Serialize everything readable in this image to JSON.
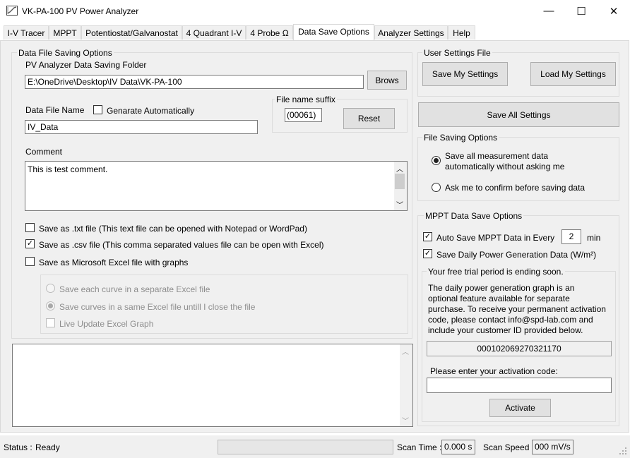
{
  "window": {
    "title": "VK-PA-100 PV Power Analyzer",
    "minimize_glyph": "—",
    "maximize_glyph": "☐",
    "close_glyph": "✕"
  },
  "tabs": [
    {
      "label": "I-V Tracer"
    },
    {
      "label": "MPPT"
    },
    {
      "label": "Potentiostat/Galvanostat"
    },
    {
      "label": "4 Quadrant I-V"
    },
    {
      "label": "4 Probe Ω"
    },
    {
      "label": "Data Save Options"
    },
    {
      "label": "Analyzer Settings"
    },
    {
      "label": "Help"
    }
  ],
  "data_file_saving": {
    "group_label": "Data File Saving Options",
    "folder_label": "PV Analyzer Data Saving Folder",
    "folder_value": "E:\\OneDrive\\Desktop\\IV Data\\VK-PA-100",
    "browse_label": "Brows",
    "file_name_label": "Data File Name",
    "generate_auto_label": "Genarate Automatically",
    "file_name_value": "IV_Data",
    "suffix_group_label": "File name suffix",
    "suffix_value": "(00061)",
    "reset_label": "Reset",
    "comment_label": "Comment",
    "comment_value": "This is test comment.",
    "save_txt_label": "Save as .txt file (This text file can be opened with Notepad or WordPad)",
    "save_csv_label": "Save as .csv file (This comma separated values file can be open with Excel)",
    "save_excel_label": "Save as Microsoft Excel file with graphs",
    "check_glyph": "✓",
    "excel_each_label": "Save each curve in a separate Excel file",
    "excel_same_label": "Save curves in a same Excel file untill I close the file",
    "excel_live_label": "Live Update Excel Graph"
  },
  "user_settings": {
    "group_label": "User Settings File",
    "save_my_label": "Save My Settings",
    "load_my_label": "Load My Settings",
    "save_all_label": "Save All Settings"
  },
  "file_saving_options": {
    "group_label": "File Saving Options",
    "auto_line1": "Save all measurement data",
    "auto_line2": "automatically without asking me",
    "ask_label": "Ask me to confirm before saving data"
  },
  "mppt_options": {
    "group_label": "MPPT Data Save Options",
    "auto_save_label": "Auto Save MPPT Data in Every",
    "interval_value": "2",
    "interval_unit": "min",
    "daily_label": "Save Daily Power Generation Data (W/m²)",
    "trial_group_label": "Your free trial period is ending soon.",
    "trial_lines": [
      "The daily power generation graph is an",
      "optional feature available for separate",
      "purchase. To receive your permanent activation",
      "code, please contact info@spd-lab.com and",
      "include your customer ID provided below."
    ],
    "customer_id": "000102069270321170",
    "activation_label": "Please enter your activation code:",
    "activation_value": "",
    "activate_label": "Activate"
  },
  "scroll_glyphs": {
    "up": "︿",
    "down": "﹀"
  },
  "status": {
    "status_label": "Status :",
    "status_value": "Ready",
    "scan_time_label": "Scan Time :",
    "scan_time_value": "0.000 s",
    "scan_speed_label": "Scan Speed :",
    "scan_speed_value": "000 mV/s"
  }
}
